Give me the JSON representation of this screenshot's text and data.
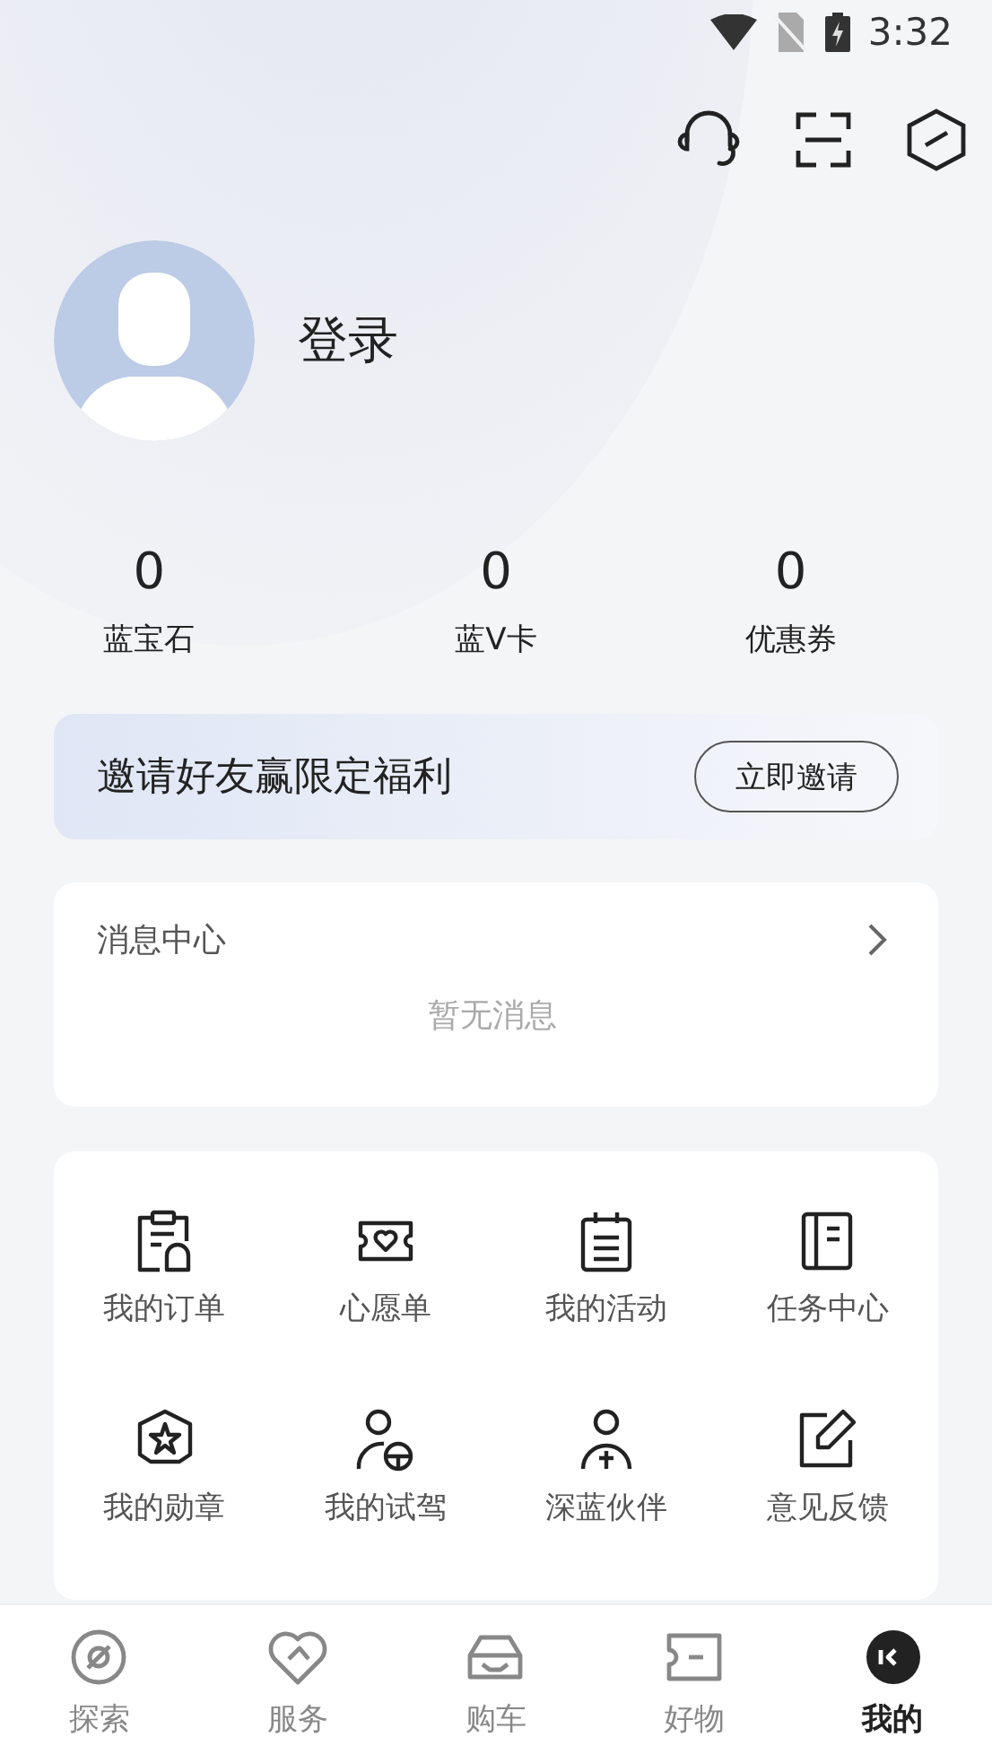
{
  "status_bar": {
    "time": "3:32"
  },
  "profile": {
    "login": "登录"
  },
  "stats": [
    {
      "value": "0",
      "label": "蓝宝石"
    },
    {
      "value": "0",
      "label": "蓝V卡"
    },
    {
      "value": "0",
      "label": "优惠券"
    }
  ],
  "invite_banner": {
    "text": "邀请好友赢限定福利",
    "button": "立即邀请"
  },
  "messages": {
    "title": "消息中心",
    "empty": "暂无消息"
  },
  "services": [
    {
      "label": "我的订单"
    },
    {
      "label": "心愿单"
    },
    {
      "label": "我的活动"
    },
    {
      "label": "任务中心"
    },
    {
      "label": "我的勋章"
    },
    {
      "label": "我的试驾"
    },
    {
      "label": "深蓝伙伴"
    },
    {
      "label": "意见反馈"
    }
  ],
  "bottom_nav": [
    {
      "label": "探索",
      "selected": false
    },
    {
      "label": "服务",
      "selected": false
    },
    {
      "label": "购车",
      "selected": false
    },
    {
      "label": "好物",
      "selected": false
    },
    {
      "label": "我的",
      "selected": true
    }
  ]
}
